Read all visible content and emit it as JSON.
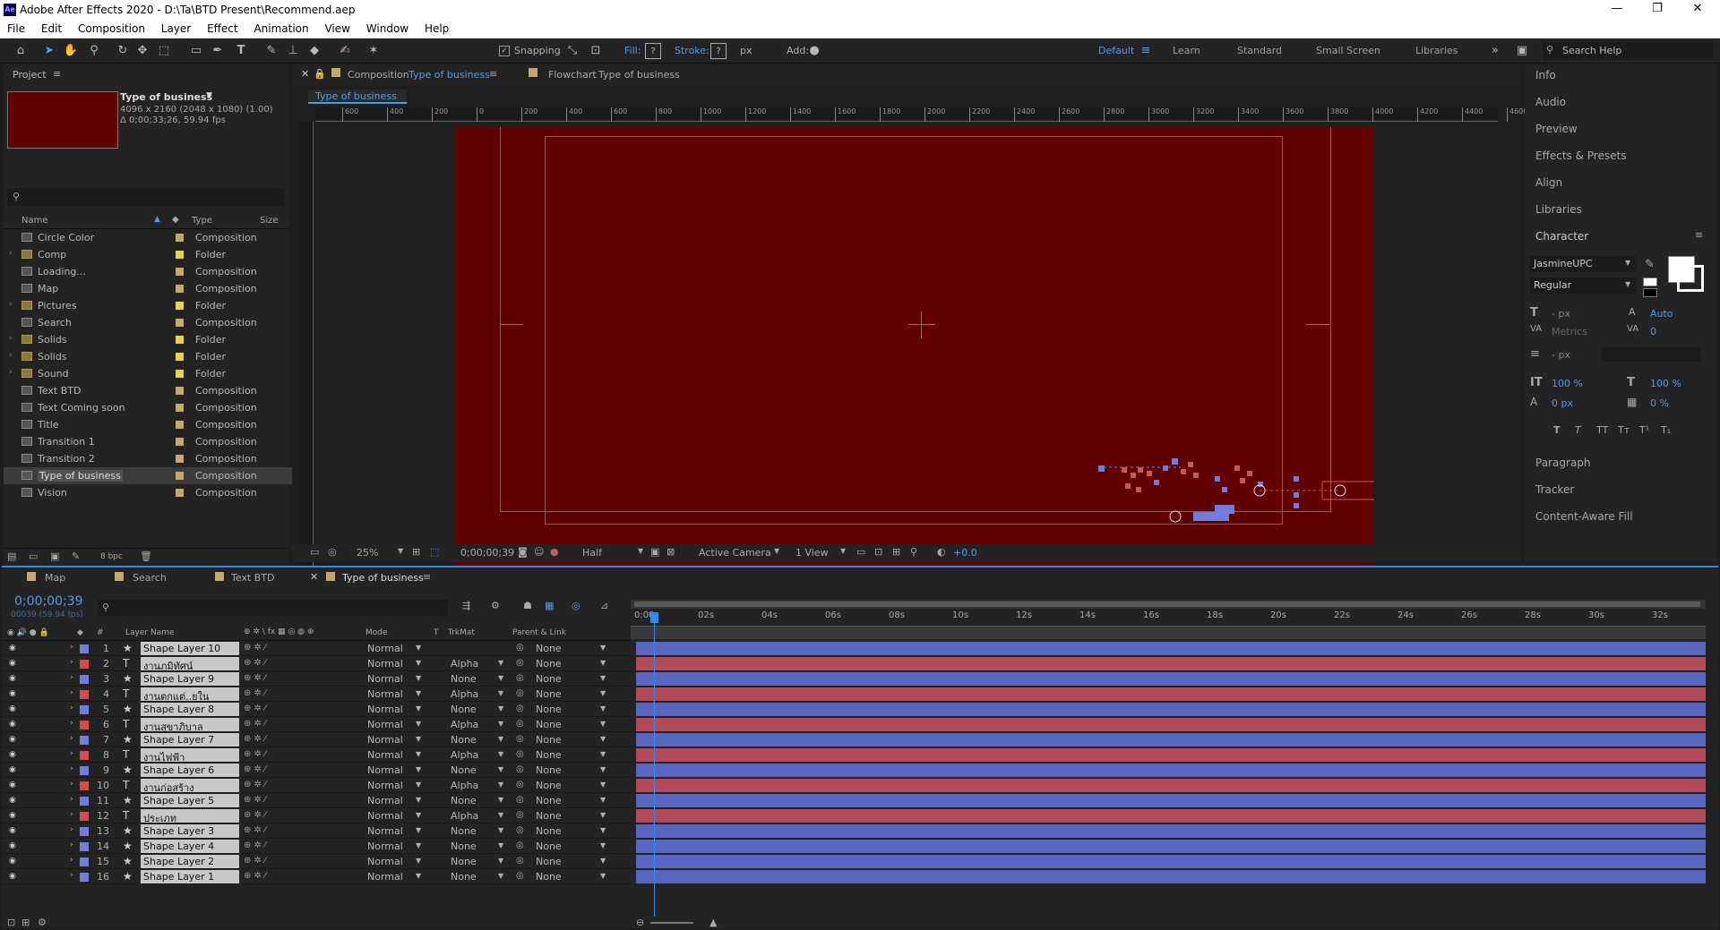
{
  "window": {
    "title": "Adobe After Effects 2020 - D:\\Ta\\BTD Present\\Recommend.aep",
    "app_icon": "Ae"
  },
  "menu": [
    "File",
    "Edit",
    "Composition",
    "Layer",
    "Effect",
    "Animation",
    "View",
    "Window",
    "Help"
  ],
  "toolbar": {
    "snapping_label": "Snapping",
    "fill_label": "Fill:",
    "stroke_label": "Stroke:",
    "stroke_units": "px",
    "add_label": "Add:",
    "workspaces": [
      "Default",
      "Learn",
      "Standard",
      "Small Screen",
      "Libraries"
    ],
    "active_workspace": "Default",
    "search_placeholder": "Search Help"
  },
  "project": {
    "panel_title": "Project",
    "selected_name": "Type of business",
    "selected_dims": "4096 x 2160  (2048 x 1080) (1.00)",
    "selected_dur": "Δ 0;00;33;26, 59.94 fps",
    "columns": {
      "name": "Name",
      "type": "Type",
      "size": "Size"
    },
    "items": [
      {
        "name": "Circle Color",
        "type": "Composition",
        "kind": "comp"
      },
      {
        "name": "Comp",
        "type": "Folder",
        "kind": "folder"
      },
      {
        "name": "Loading...",
        "type": "Composition",
        "kind": "comp"
      },
      {
        "name": "Map",
        "type": "Composition",
        "kind": "comp"
      },
      {
        "name": "Pictures",
        "type": "Folder",
        "kind": "folder"
      },
      {
        "name": "Search",
        "type": "Composition",
        "kind": "comp"
      },
      {
        "name": "Solids",
        "type": "Folder",
        "kind": "folder"
      },
      {
        "name": "Solids",
        "type": "Folder",
        "kind": "folder"
      },
      {
        "name": "Sound",
        "type": "Folder",
        "kind": "folder"
      },
      {
        "name": "Text BTD",
        "type": "Composition",
        "kind": "comp"
      },
      {
        "name": "Text Coming soon",
        "type": "Composition",
        "kind": "comp"
      },
      {
        "name": "Title",
        "type": "Composition",
        "kind": "comp"
      },
      {
        "name": "Transition 1",
        "type": "Composition",
        "kind": "comp"
      },
      {
        "name": "Transition 2",
        "type": "Composition",
        "kind": "comp"
      },
      {
        "name": "Type of business",
        "type": "Composition",
        "kind": "comp",
        "selected": true
      },
      {
        "name": "Vision",
        "type": "Composition",
        "kind": "comp"
      }
    ],
    "bpc": "8 bpc"
  },
  "comp_viewer": {
    "tab1_prefix": "Composition",
    "tab1_name": "Type of business",
    "tab2_prefix": "Flowchart",
    "tab2_name": "Type of business",
    "breadcrumb": "Type of business",
    "ruler_labels": [
      "600",
      "400",
      "200",
      "0",
      "200",
      "400",
      "600",
      "800",
      "1000",
      "1200",
      "1400",
      "1600",
      "1800",
      "2000",
      "2200",
      "2400",
      "2600",
      "2800",
      "3000",
      "3200",
      "3400",
      "3600",
      "3800",
      "4000",
      "4200",
      "4400",
      "4600"
    ],
    "zoom": "25%",
    "timecode": "0;00;00;39",
    "resolution": "Half",
    "camera": "Active Camera",
    "views": "1 View",
    "exposure": "+0.0",
    "bg_color": "#620000"
  },
  "right_panels": [
    "Info",
    "Audio",
    "Preview",
    "Effects & Presets",
    "Align",
    "Libraries"
  ],
  "character": {
    "title": "Character",
    "font": "JasmineUPC",
    "style": "Regular",
    "size": "- px",
    "leading": "Auto",
    "kerning": "Metrics",
    "tracking": "0",
    "stroke": "- px",
    "vscale": "100 %",
    "hscale": "100 %",
    "baseline": "0 px",
    "tsume": "0 %"
  },
  "right_panels2": [
    "Paragraph",
    "Tracker",
    "Content-Aware Fill"
  ],
  "timeline": {
    "tabs": [
      "Map",
      "Search",
      "Text BTD",
      "Type of business"
    ],
    "active_tab": "Type of business",
    "timecode": "0;00;00;39",
    "frames": "00039 (59.94 fps)",
    "columns": {
      "num": "#",
      "name": "Layer Name",
      "mode": "Mode",
      "t": "T",
      "trkmat": "TrkMat",
      "parent": "Parent & Link"
    },
    "time_labels": [
      "0:00s",
      "02s",
      "04s",
      "06s",
      "08s",
      "10s",
      "12s",
      "14s",
      "16s",
      "18s",
      "20s",
      "22s",
      "24s",
      "26s",
      "28s",
      "30s",
      "32s"
    ],
    "layers": [
      {
        "num": "1",
        "type": "shape",
        "name": "Shape Layer 10",
        "mode": "Normal",
        "trkmat": "",
        "parent": "None",
        "color": "blue"
      },
      {
        "num": "2",
        "type": "text",
        "name": "งานภูมิทัศน์",
        "mode": "Normal",
        "trkmat": "Alpha",
        "parent": "None",
        "color": "red"
      },
      {
        "num": "3",
        "type": "shape",
        "name": "Shape Layer 9",
        "mode": "Normal",
        "trkmat": "None",
        "parent": "None",
        "color": "blue"
      },
      {
        "num": "4",
        "type": "text",
        "name": "งานตกแต่..ยใน",
        "mode": "Normal",
        "trkmat": "Alpha",
        "parent": "None",
        "color": "red"
      },
      {
        "num": "5",
        "type": "shape",
        "name": "Shape Layer 8",
        "mode": "Normal",
        "trkmat": "None",
        "parent": "None",
        "color": "blue"
      },
      {
        "num": "6",
        "type": "text",
        "name": "งานสุขาภิบาล",
        "mode": "Normal",
        "trkmat": "Alpha",
        "parent": "None",
        "color": "red"
      },
      {
        "num": "7",
        "type": "shape",
        "name": "Shape Layer 7",
        "mode": "Normal",
        "trkmat": "None",
        "parent": "None",
        "color": "blue"
      },
      {
        "num": "8",
        "type": "text",
        "name": "งานไฟฟ้า",
        "mode": "Normal",
        "trkmat": "Alpha",
        "parent": "None",
        "color": "red"
      },
      {
        "num": "9",
        "type": "shape",
        "name": "Shape Layer 6",
        "mode": "Normal",
        "trkmat": "None",
        "parent": "None",
        "color": "blue"
      },
      {
        "num": "10",
        "type": "text",
        "name": "งานก่อสร้าง",
        "mode": "Normal",
        "trkmat": "Alpha",
        "parent": "None",
        "color": "red"
      },
      {
        "num": "11",
        "type": "shape",
        "name": "Shape Layer 5",
        "mode": "Normal",
        "trkmat": "None",
        "parent": "None",
        "color": "blue"
      },
      {
        "num": "12",
        "type": "text",
        "name": "ประเภท",
        "mode": "Normal",
        "trkmat": "Alpha",
        "parent": "None",
        "color": "red"
      },
      {
        "num": "13",
        "type": "shape",
        "name": "Shape Layer 3",
        "mode": "Normal",
        "trkmat": "None",
        "parent": "None",
        "color": "blue"
      },
      {
        "num": "14",
        "type": "shape",
        "name": "Shape Layer 4",
        "mode": "Normal",
        "trkmat": "None",
        "parent": "None",
        "color": "blue"
      },
      {
        "num": "15",
        "type": "shape",
        "name": "Shape Layer 2",
        "mode": "Normal",
        "trkmat": "None",
        "parent": "None",
        "color": "blue"
      },
      {
        "num": "16",
        "type": "shape",
        "name": "Shape Layer 1",
        "mode": "Normal",
        "trkmat": "None",
        "parent": "None",
        "color": "blue"
      }
    ]
  },
  "colors": {
    "accent": "#2d8ceb",
    "label_blue": "#6f7ddc",
    "label_red": "#d84a4a",
    "label_yellow": "#e6d24a"
  }
}
